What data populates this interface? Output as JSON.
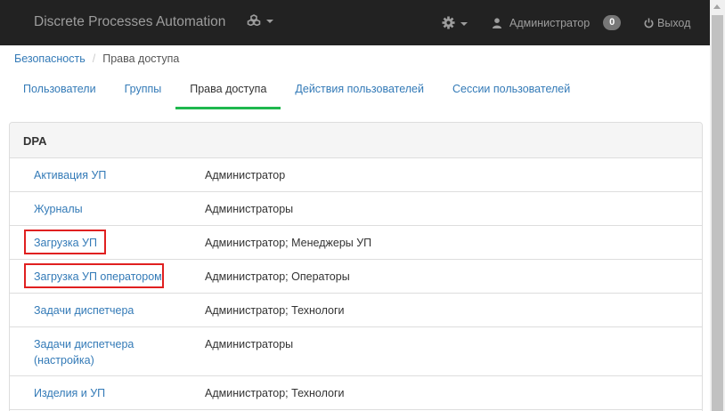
{
  "navbar": {
    "brand": "Discrete Processes Automation",
    "apps_icon": "cubes-icon",
    "settings_icon": "gear-icon",
    "user_icon": "user-icon",
    "user_name": "Администратор",
    "notifications_count": "0",
    "logout_icon": "power-icon",
    "logout_label": "Выход"
  },
  "breadcrumb": {
    "root": "Безопасность",
    "separator": "/",
    "current": "Права доступа"
  },
  "tabs": [
    {
      "label": "Пользователи",
      "active": false
    },
    {
      "label": "Группы",
      "active": false
    },
    {
      "label": "Права доступа",
      "active": true
    },
    {
      "label": "Действия пользователей",
      "active": false
    },
    {
      "label": "Сессии пользователей",
      "active": false
    }
  ],
  "panel": {
    "title": "DPA",
    "rows": [
      {
        "name": "Активация УП",
        "roles": "Администратор",
        "highlighted": false
      },
      {
        "name": "Журналы",
        "roles": "Администраторы",
        "highlighted": false
      },
      {
        "name": "Загрузка УП",
        "roles": "Администратор; Менеджеры УП",
        "highlighted": true
      },
      {
        "name": "Загрузка УП оператором",
        "roles": "Администратор; Операторы",
        "highlighted": true
      },
      {
        "name": "Задачи диспетчера",
        "roles": "Администратор; Технологи",
        "highlighted": false
      },
      {
        "name": "Задачи диспетчера (настройка)",
        "roles": "Администраторы",
        "highlighted": false
      },
      {
        "name": "Изделия и УП",
        "roles": "Администратор; Технологи",
        "highlighted": false
      }
    ]
  },
  "colors": {
    "navbar_bg": "#222222",
    "link": "#337ab7",
    "active_tab_underline": "#1fb84e",
    "highlight_box": "#e02020"
  }
}
